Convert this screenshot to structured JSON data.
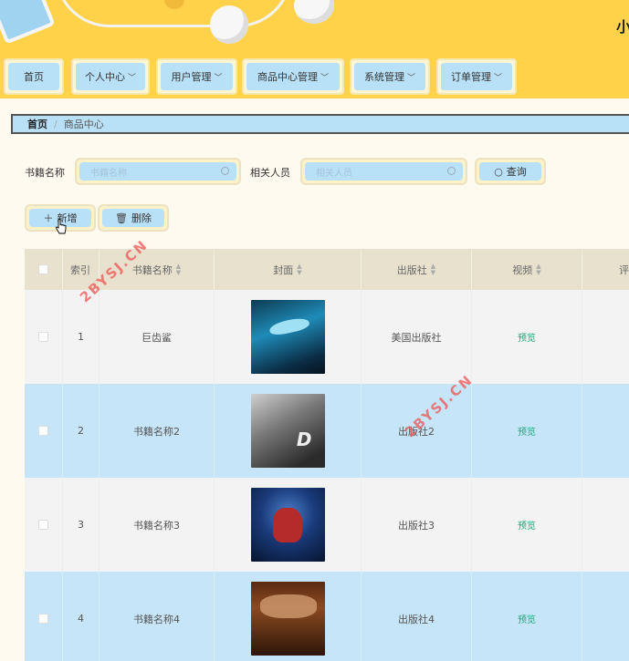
{
  "header": {
    "site_title": "小"
  },
  "nav": {
    "items": [
      {
        "label": "首页",
        "has_dropdown": false
      },
      {
        "label": "个人中心",
        "has_dropdown": true
      },
      {
        "label": "用户管理",
        "has_dropdown": true
      },
      {
        "label": "商品中心管理",
        "has_dropdown": true
      },
      {
        "label": "系统管理",
        "has_dropdown": true
      },
      {
        "label": "订单管理",
        "has_dropdown": true
      }
    ]
  },
  "breadcrumb": {
    "home": "首页",
    "separator": "/",
    "current": "商品中心"
  },
  "search": {
    "book_name_label": "书籍名称",
    "book_name_placeholder": "书籍名称",
    "related_label": "相关人员",
    "related_placeholder": "相关人员",
    "query_button": "查询"
  },
  "actions": {
    "add_button": "新增",
    "delete_button": "删除"
  },
  "table": {
    "columns": [
      "索引",
      "书籍名称",
      "封面",
      "出版社",
      "视频",
      "评"
    ],
    "rows": [
      {
        "index": "1",
        "name": "巨齿鲨",
        "cover": "cover1",
        "publisher": "美国出版社",
        "video": "预览"
      },
      {
        "index": "2",
        "name": "书籍名称2",
        "cover": "cover2",
        "publisher": "出版社2",
        "video": "预览"
      },
      {
        "index": "3",
        "name": "书籍名称3",
        "cover": "cover3",
        "publisher": "出版社3",
        "video": "预览"
      },
      {
        "index": "4",
        "name": "书籍名称4",
        "cover": "cover4",
        "publisher": "出版社4",
        "video": "预览"
      }
    ]
  },
  "watermark": "2BYSJ.CN",
  "colors": {
    "banner": "#ffd24a",
    "accent_blue": "#b8e0f7",
    "row_highlight": "#c6e5f8",
    "preview_link": "#28a07a",
    "watermark": "#e55555"
  }
}
